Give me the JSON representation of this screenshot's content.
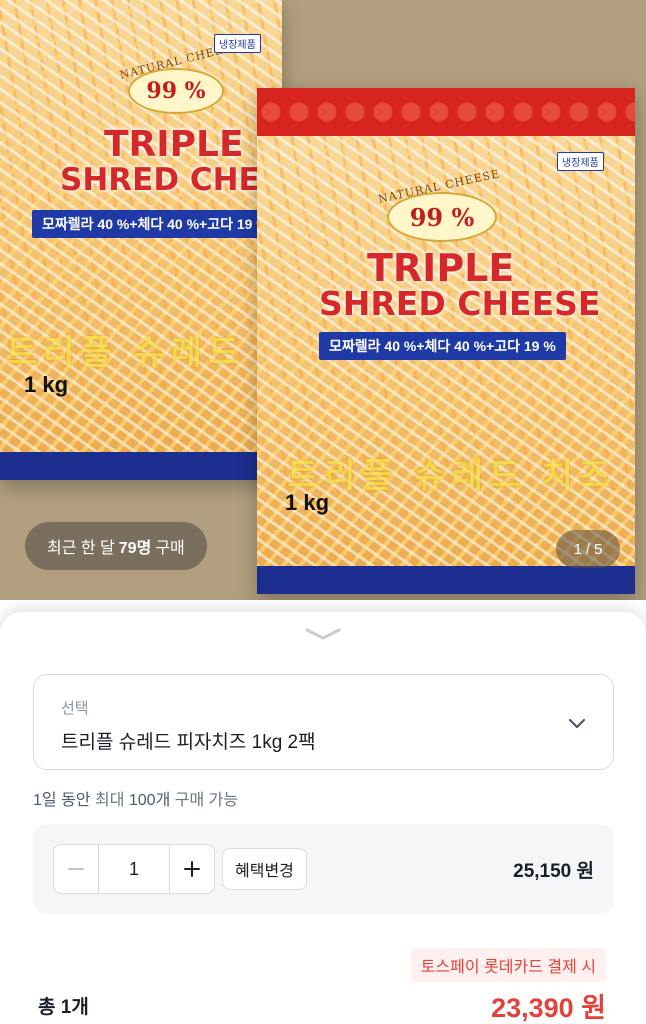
{
  "product_image": {
    "seal_text": "99 %",
    "seal_arc": "NATURAL CHEESE",
    "title_line1": "TRIPLE",
    "title_line2": "SHRED CHEESE",
    "ratio_text": "모짜렐라 40 %+체다 40 %+고다 19 %",
    "korean_name": "트리플 슈레드 치즈",
    "weight": "1 kg",
    "frozen_label": "냉장제품"
  },
  "purchase_pill": {
    "prefix": "최근 한 달",
    "count": "79명",
    "suffix": "구매"
  },
  "pager": {
    "current": "1",
    "separator": "/",
    "total": "5"
  },
  "option_select": {
    "caption": "선택",
    "value": "트리플 슈레드 피자치즈 1kg 2팩"
  },
  "limit": {
    "part1": "1일 동안",
    "part2": "최대",
    "part3": "100개",
    "part4": "구매 가능"
  },
  "option_row": {
    "quantity": "1",
    "benefit_button": "혜택변경",
    "price": "25,150 원"
  },
  "summary": {
    "promo": "토스페이 롯데카드 결제 시",
    "total_label": "총 1개",
    "total_price": "23,390 원"
  },
  "colors": {
    "accent_red": "#e5413b",
    "text_primary": "#191f28",
    "text_secondary": "#8b95a1"
  }
}
